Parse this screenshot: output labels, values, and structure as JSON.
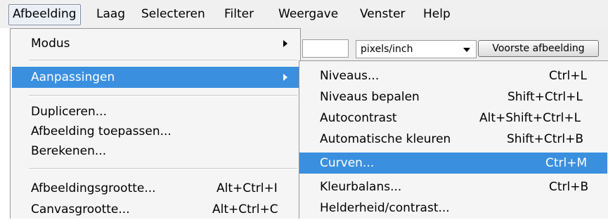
{
  "menubar": {
    "items": [
      "Afbeelding",
      "Laag",
      "Selecteren",
      "Filter",
      "Weergave",
      "Venster",
      "Help"
    ]
  },
  "toolbar": {
    "unit_select": "pixels/inch",
    "front_image_button": "Voorste afbeelding"
  },
  "menu": {
    "modus": "Modus",
    "aanpassingen": "Aanpassingen",
    "dupliceren": "Dupliceren...",
    "afbeelding_toepassen": "Afbeelding toepassen...",
    "berekenen": "Berekenen...",
    "afbeeldingsgrootte": {
      "label": "Afbeeldingsgrootte...",
      "shortcut": "Alt+Ctrl+I"
    },
    "canvasgrootte": {
      "label": "Canvasgrootte...",
      "shortcut": "Alt+Ctrl+C"
    }
  },
  "submenu": {
    "items": [
      {
        "label": "Niveaus...",
        "shortcut": "Ctrl+L"
      },
      {
        "label": "Niveaus bepalen",
        "shortcut": "Shift+Ctrl+L"
      },
      {
        "label": "Autocontrast",
        "shortcut": "Alt+Shift+Ctrl+L"
      },
      {
        "label": "Automatische kleuren",
        "shortcut": "Shift+Ctrl+B"
      },
      {
        "label": "Curven...",
        "shortcut": "Ctrl+M"
      },
      {
        "label": "Kleurbalans...",
        "shortcut": "Ctrl+B"
      },
      {
        "label": "Helderheid/contrast...",
        "shortcut": ""
      }
    ]
  },
  "colors": {
    "highlight": "#3b8fdf",
    "menu_bg": "#f5f5f5",
    "menubar_bg": "#f0f0f0"
  }
}
